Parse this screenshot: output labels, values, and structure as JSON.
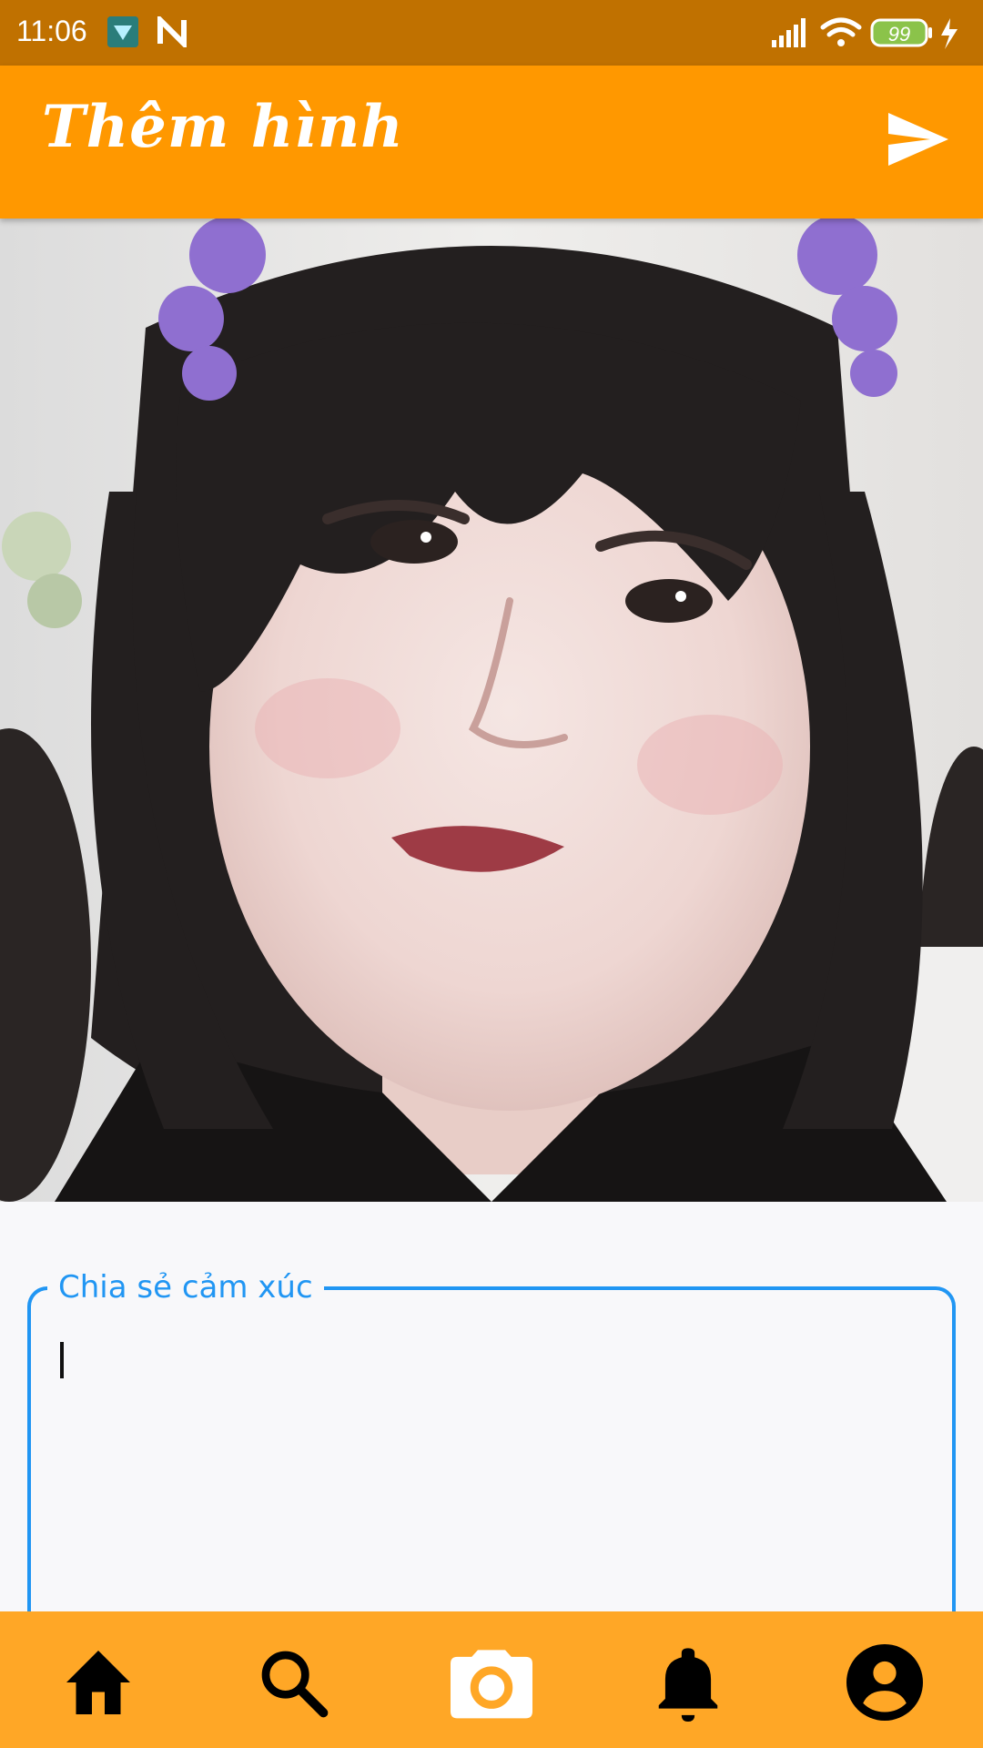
{
  "status_bar": {
    "time": "11:06",
    "battery": "99"
  },
  "app_bar": {
    "title": "Thêm hình",
    "send_icon": "send-icon"
  },
  "caption": {
    "label": "Chia sẻ cảm xúc",
    "value": ""
  },
  "bottom_nav": {
    "items": [
      {
        "icon": "home-icon"
      },
      {
        "icon": "search-icon"
      },
      {
        "icon": "camera-icon",
        "active": true
      },
      {
        "icon": "bell-icon"
      },
      {
        "icon": "account-icon"
      }
    ]
  },
  "colors": {
    "status_bar": "#c07100",
    "app_bar": "#ff9800",
    "nav_bar": "#ffa726",
    "focus_blue": "#2196f3"
  }
}
